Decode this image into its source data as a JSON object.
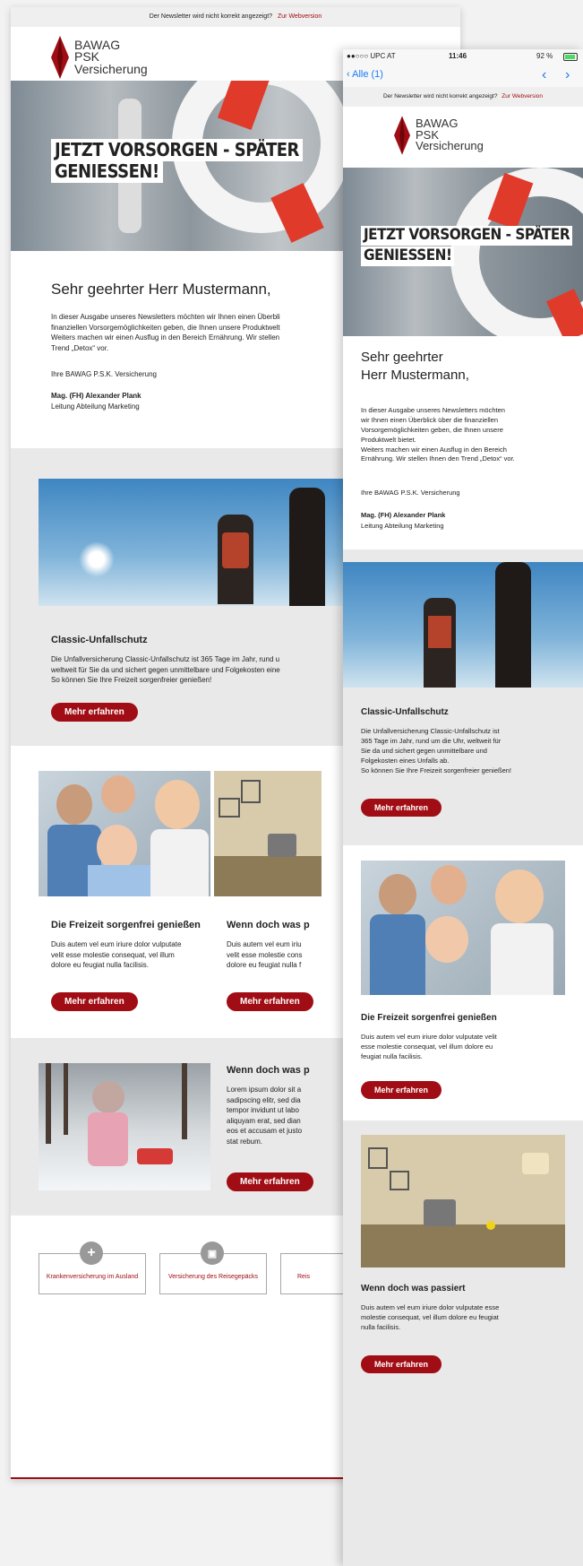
{
  "desktop": {
    "topbar": {
      "text": "Der Newsletter wird nicht korrekt angezeigt?",
      "link": "Zur Webversion"
    },
    "logo": {
      "line1": "BAWAG",
      "line2": "PSK",
      "line3": "Versicherung"
    },
    "hero": {
      "line1": "JETZT VORSORGEN - SPÄTER",
      "line2": "GENIESSEN!"
    },
    "greeting": "Sehr geehrter Herr Mustermann,",
    "intro": [
      "In dieser Ausgabe unseres Newsletters möchten wir Ihnen einen Überbli",
      "finanziellen Vorsorgemöglichkeiten geben, die Ihnen unsere Produktwelt",
      "Weiters machen wir einen Ausflug in den Bereich Ernährung. Wir stellen",
      "Trend „Detox“ vor."
    ],
    "signoff": "Ihre BAWAG P.S.K. Versicherung",
    "signer": "Mag. (FH) Alexander Plank",
    "signer_role": "Leitung Abteilung Marketing",
    "classic": {
      "title": "Classic-Unfallschutz",
      "lines": [
        "Die Unfallversicherung Classic-Unfallschutz ist 365 Tage im Jahr, rund u",
        "weltweit für Sie da und sichert gegen unmittelbare und Folgekosten eine",
        "So können Sie Ihre Freizeit sorgenfreier genießen!"
      ],
      "button": "Mehr erfahren"
    },
    "freizeit": {
      "title": "Die Freizeit sorgenfrei genießen",
      "lines": [
        "Duis autem vel eum iriure dolor vulputate",
        "velit esse molestie consequat, vel illum",
        "dolore eu feugiat nulla facilisis."
      ],
      "button": "Mehr erfahren"
    },
    "passiert": {
      "title": "Wenn doch was p",
      "lines": [
        "Duis autem vel eum iriu",
        "velit esse molestie cons",
        "dolore eu feugiat nulla f"
      ],
      "button": "Mehr erfahren"
    },
    "winter": {
      "title": "Wenn doch was p",
      "lines": [
        "Lorem ipsum dolor sit a",
        "sadipscing elitr, sed dia",
        "tempor invidunt ut labo",
        "aliquyam erat, sed dian",
        "eos et accusam et justo",
        "stat rebum."
      ],
      "button": "Mehr erfahren"
    },
    "footer": {
      "items": [
        "Krankenversicherung im Ausland",
        "Versicherung des Reisegepäcks",
        "Reis"
      ]
    }
  },
  "mobile": {
    "status": {
      "carrier": "●●○○○ UPC AT",
      "time": "11:46",
      "battery": "92 %"
    },
    "nav": {
      "back": "Alle (1)"
    },
    "topbar": {
      "text": "Der Newsletter wird nicht korrekt angezeigt?",
      "link": "Zur Webversion"
    },
    "logo": {
      "line1": "BAWAG",
      "line2": "PSK",
      "line3": "Versicherung"
    },
    "hero": {
      "line1": "JETZT VORSORGEN - SPÄTER",
      "line2": "GENIESSEN!"
    },
    "greeting1": "Sehr geehrter",
    "greeting2": "Herr Mustermann,",
    "intro": [
      "In dieser Ausgabe unseres Newsletters möchten",
      "wir Ihnen einen Überblick über die finanziellen",
      "Vorsorgemöglichkeiten geben, die Ihnen unsere",
      "Produktwelt bietet.",
      "Weiters machen wir einen Ausflug in den Bereich",
      "Ernährung. Wir stellen Ihnen den Trend „Detox“ vor."
    ],
    "signoff": "Ihre BAWAG P.S.K. Versicherung",
    "signer": "Mag. (FH) Alexander Plank",
    "signer_role": "Leitung Abteilung Marketing",
    "classic": {
      "title": "Classic-Unfallschutz",
      "lines": [
        "Die Unfallversicherung Classic-Unfallschutz ist",
        "365 Tage im Jahr, rund um die Uhr, weltweit für",
        "Sie da und sichert gegen unmittelbare und",
        "Folgekosten eines Unfalls ab.",
        "So können Sie Ihre Freizeit sorgenfreier genießen!"
      ],
      "button": "Mehr erfahren"
    },
    "freizeit": {
      "title": "Die Freizeit sorgenfrei genießen",
      "lines": [
        "Duis autem vel eum iriure dolor vulputate velit",
        "esse molestie consequat, vel illum dolore eu",
        "feugiat nulla facilisis."
      ],
      "button": "Mehr erfahren"
    },
    "passiert": {
      "title": "Wenn doch was passiert",
      "lines": [
        "Duis autem vel eum iriure dolor vulputate esse",
        "molestie consequat, vel illum dolore eu feugiat",
        "nulla facilisis."
      ],
      "button": "Mehr erfahren"
    }
  },
  "colors": {
    "brand_red": "#a10d14",
    "section_grey": "#e9e9e9"
  }
}
